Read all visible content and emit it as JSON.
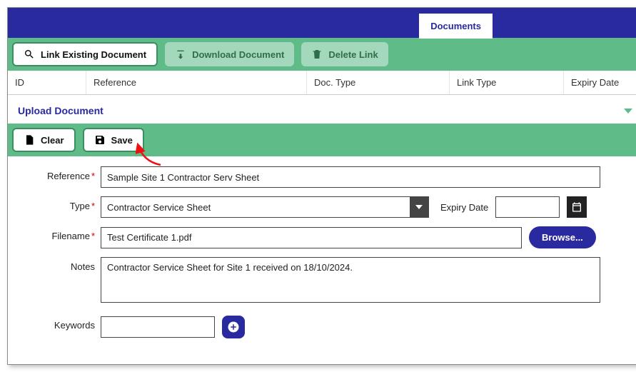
{
  "header": {
    "active_tab": "Documents"
  },
  "toolbar": {
    "link_existing": "Link Existing Document",
    "download": "Download Document",
    "delete_link": "Delete Link"
  },
  "grid": {
    "headers": {
      "id": "ID",
      "reference": "Reference",
      "doc_type": "Doc. Type",
      "link_type": "Link Type",
      "expiry": "Expiry Date"
    }
  },
  "section": {
    "title": "Upload Document"
  },
  "formbar": {
    "clear": "Clear",
    "save": "Save"
  },
  "form": {
    "labels": {
      "reference": "Reference",
      "type": "Type",
      "expiry": "Expiry Date",
      "filename": "Filename",
      "notes": "Notes",
      "keywords": "Keywords",
      "browse": "Browse..."
    },
    "values": {
      "reference": "Sample Site 1 Contractor Serv Sheet",
      "type": "Contractor Service Sheet",
      "expiry": "",
      "filename": "Test Certificate 1.pdf",
      "notes": "Contractor Service Sheet for Site 1 received on 18/10/2024.",
      "keywords": ""
    }
  }
}
